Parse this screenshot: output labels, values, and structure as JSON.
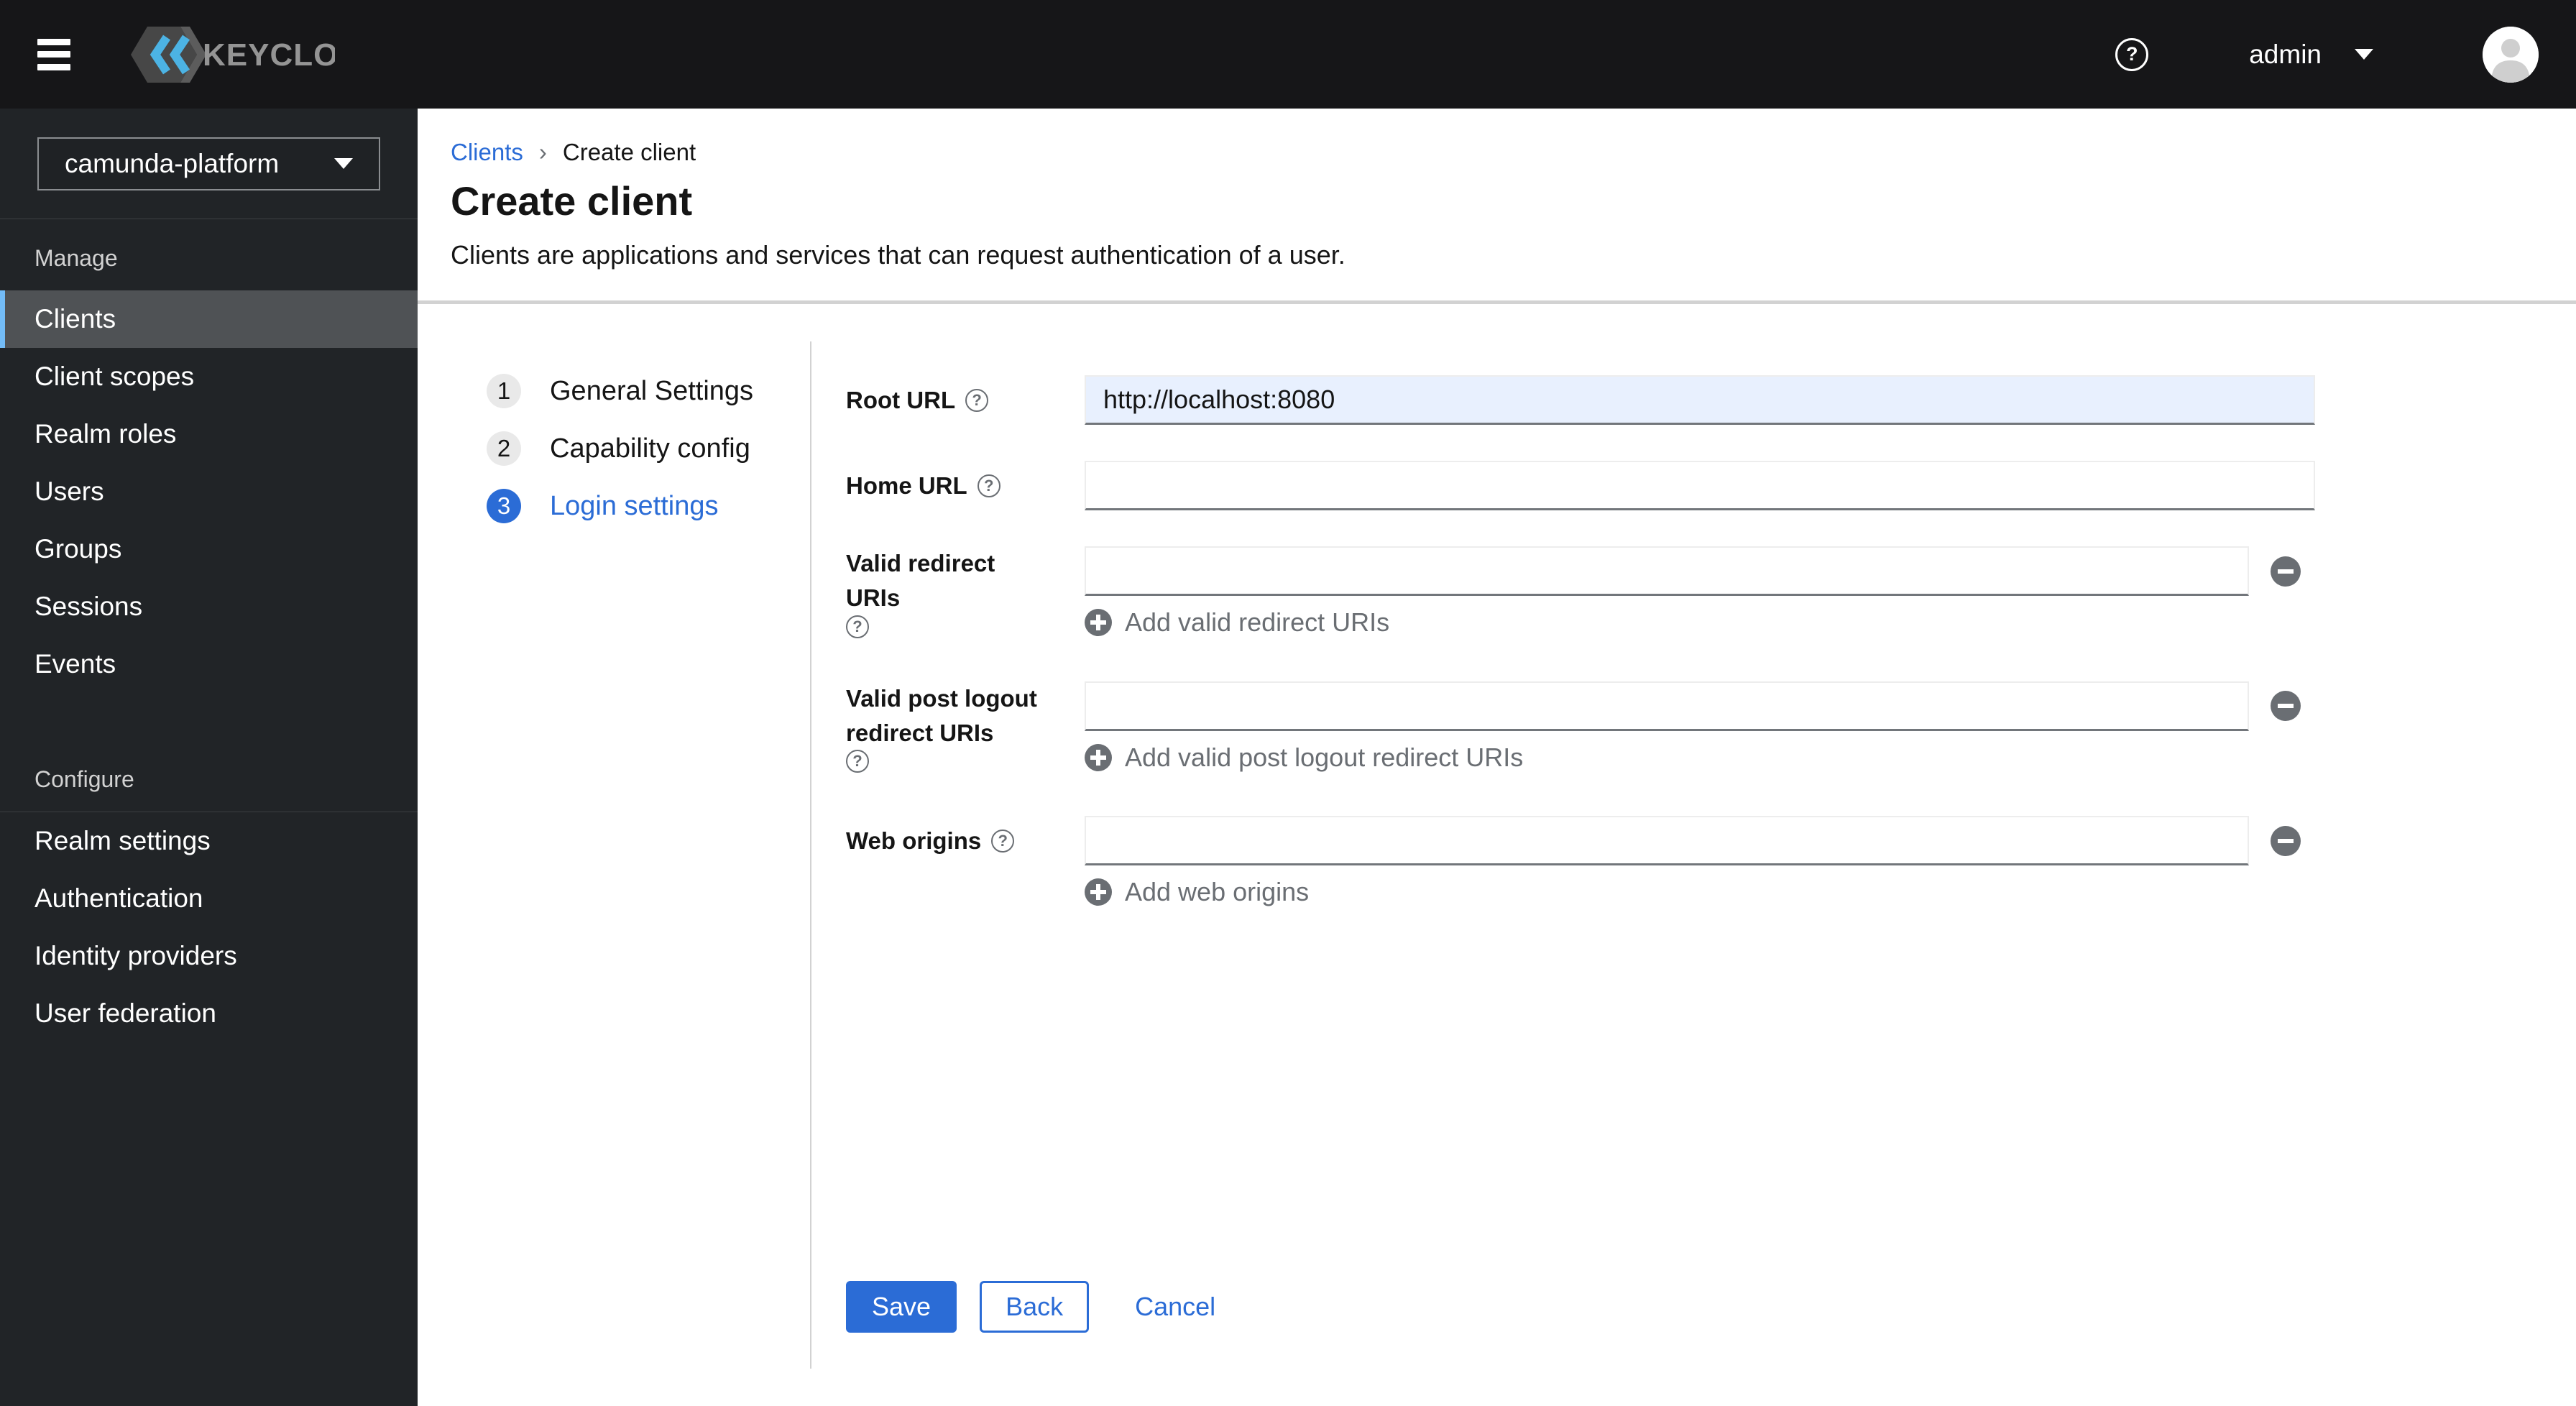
{
  "colors": {
    "primary": "#2b6cd6",
    "masthead-bg": "#161618",
    "sidebar-bg": "#212427",
    "sidebar-active-bg": "#4f5255",
    "sidebar-active-border": "#73bcf7",
    "autofill-bg": "#e8f0fe"
  },
  "masthead": {
    "brand": "KEYCLOAK",
    "help_icon": "?",
    "user": "admin"
  },
  "sidebar": {
    "realm_selector": "camunda-platform",
    "sections": [
      {
        "label": "Manage",
        "items": [
          {
            "label": "Clients"
          },
          {
            "label": "Client scopes"
          },
          {
            "label": "Realm roles"
          },
          {
            "label": "Users"
          },
          {
            "label": "Groups"
          },
          {
            "label": "Sessions"
          },
          {
            "label": "Events"
          }
        ]
      },
      {
        "label": "Configure",
        "items": [
          {
            "label": "Realm settings"
          },
          {
            "label": "Authentication"
          },
          {
            "label": "Identity providers"
          },
          {
            "label": "User federation"
          }
        ]
      }
    ]
  },
  "breadcrumb": {
    "link": "Clients",
    "separator": "›",
    "current": "Create client"
  },
  "page": {
    "title": "Create client",
    "subtitle": "Clients are applications and services that can request authentication of a user."
  },
  "wizard": {
    "steps": [
      {
        "number": "1",
        "label": "General Settings"
      },
      {
        "number": "2",
        "label": "Capability config"
      },
      {
        "number": "3",
        "label": "Login settings"
      }
    ]
  },
  "form": {
    "help_icon": "?",
    "fields": [
      {
        "label": "Root URL",
        "value": "http://localhost:8080"
      },
      {
        "label": "Home URL",
        "value": ""
      },
      {
        "label": "Valid redirect URIs",
        "value": "",
        "add_label": "Add valid redirect URIs"
      },
      {
        "label": "Valid post logout redirect URIs",
        "value": "",
        "add_label": "Add valid post logout redirect URIs"
      },
      {
        "label": "Web origins",
        "value": "",
        "add_label": "Add web origins"
      }
    ],
    "buttons": {
      "save": "Save",
      "back": "Back",
      "cancel": "Cancel"
    }
  }
}
